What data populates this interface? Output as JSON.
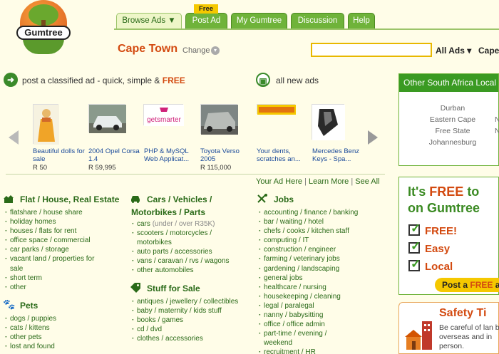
{
  "header": {
    "logo_text": "Gumtree",
    "tabs": [
      {
        "label": "Browse Ads ▼"
      },
      {
        "label": "Post Ad"
      },
      {
        "label": "My Gumtree"
      },
      {
        "label": "Discussion"
      },
      {
        "label": "Help"
      }
    ],
    "free_flag": "Free",
    "location": "Cape Town",
    "change_label": "Change",
    "search": {
      "value": "",
      "placeholder": ""
    },
    "scope_label": "All Ads ▾",
    "cut_location": "Cape"
  },
  "promo": {
    "post_prefix": "post a classified ad - quick, simple & ",
    "post_free": "FREE",
    "all_new": "all new ads"
  },
  "ads": [
    {
      "caption": "Beautiful dolls for sale",
      "price": "R 50"
    },
    {
      "caption": "2004 Opel Corsa 1.4",
      "price": "R 59,995"
    },
    {
      "caption": "PHP & MySQL Web Applicat...",
      "price": ""
    },
    {
      "caption": "Toyota Verso 2005",
      "price": "R 115,000"
    },
    {
      "caption": "Your dents, scratches an...",
      "price": ""
    },
    {
      "caption": "Mercedes Benz Keys - Spa...",
      "price": ""
    }
  ],
  "ad_links": {
    "your_ad": "Your Ad Here",
    "learn": "Learn More",
    "see_all": "See All",
    "sep": "|"
  },
  "categories": {
    "flat": {
      "head": "Flat / House, Real Estate",
      "items": [
        "flatshare / house share",
        "holiday homes",
        "houses / flats for rent",
        "office space / commercial",
        "car parks / storage",
        "vacant land / properties for sale",
        "short term",
        "other"
      ]
    },
    "pets": {
      "head": "Pets",
      "items": [
        "dogs / puppies",
        "cats / kittens",
        "other pets",
        "lost and found"
      ]
    },
    "cars": {
      "head_line1": "Cars / Vehicles /",
      "head_line2": "Motorbikes / Parts",
      "items": [
        "cars",
        "scooters / motorcycles / motorbikes",
        "auto parts / accessories",
        "vans / caravan / rvs / wagons",
        "other automobiles"
      ],
      "cars_note": "(under / over R35K)"
    },
    "stuff": {
      "head": "Stuff for Sale",
      "items": [
        "antiques / jewellery / collectibles",
        "baby / maternity / kids stuff",
        "books / games",
        "cd / dvd",
        "clothes / accessories"
      ]
    },
    "jobs": {
      "head": "Jobs",
      "items": [
        "accounting / finance / banking",
        "bar / waiting / hotel",
        "chefs / cooks / kitchen staff",
        "computing / IT",
        "construction / engineer",
        "farming / veterinary jobs",
        "gardening / landscaping",
        "general jobs",
        "healthcare / nursing",
        "housekeeping / cleaning",
        "legal / paralegal",
        "nanny / babysitting",
        "office / office admin",
        "part-time / evening / weekend",
        "recruitment / HR"
      ]
    }
  },
  "right": {
    "regions_head": "Other South Africa Local",
    "regions": [
      "Durban",
      "Eastern Cape",
      "Free State",
      "Johannesburg"
    ],
    "regions_cut": [
      "N",
      "N"
    ],
    "free_title": {
      "prefix": "It's ",
      "accent": "FREE",
      "suffix": " to",
      "line2": "on Gumtree"
    },
    "checks": [
      "FREE!",
      "Easy",
      "Local"
    ],
    "post_free": {
      "prefix": "Post a ",
      "accent": "FREE",
      "suffix": " a"
    },
    "safety_head": "Safety Ti",
    "safety_text": "Be careful of lan be overseas and in person."
  },
  "colors": {
    "brand_green": "#3a8a22",
    "accent_orange": "#d34a10",
    "tab_green": "#6fb33a",
    "highlight_yellow": "#f5c800"
  }
}
